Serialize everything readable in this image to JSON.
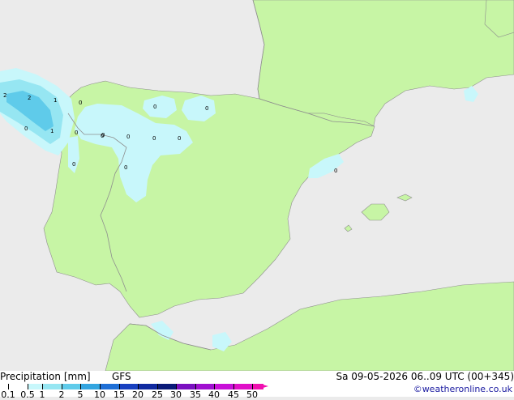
{
  "map": {
    "colors": {
      "sea": "#ebebeb",
      "land": "#c7f5a5",
      "border": "#8e8e8e",
      "precip_light": "#c8f7fb",
      "precip_mid": "#96e6f2",
      "precip_high": "#5fcbea"
    },
    "contour_labels": [
      "2",
      "2",
      "1",
      "0",
      "0",
      "1",
      "0",
      "0",
      "0",
      "0",
      "0",
      "0",
      "0",
      "0",
      "0",
      "0",
      "0"
    ]
  },
  "footer": {
    "title": "Precipitation [mm]",
    "model": "GFS",
    "datetime": "Sa 09-05-2026 06..09 UTC (00+345)",
    "credit": "©weatheronline.co.uk"
  },
  "legend": {
    "ticks": [
      "0.1",
      "0.5",
      "1",
      "2",
      "5",
      "10",
      "15",
      "20",
      "25",
      "30",
      "35",
      "40",
      "45",
      "50"
    ],
    "colors": [
      "#ffffff",
      "#c8f7fb",
      "#96e6f2",
      "#5fcbea",
      "#33a5e0",
      "#1e6fd6",
      "#1840c0",
      "#102aa0",
      "#0a1a78",
      "#7a10c0",
      "#a010d0",
      "#c810d8",
      "#e010c8",
      "#f010b0"
    ]
  }
}
